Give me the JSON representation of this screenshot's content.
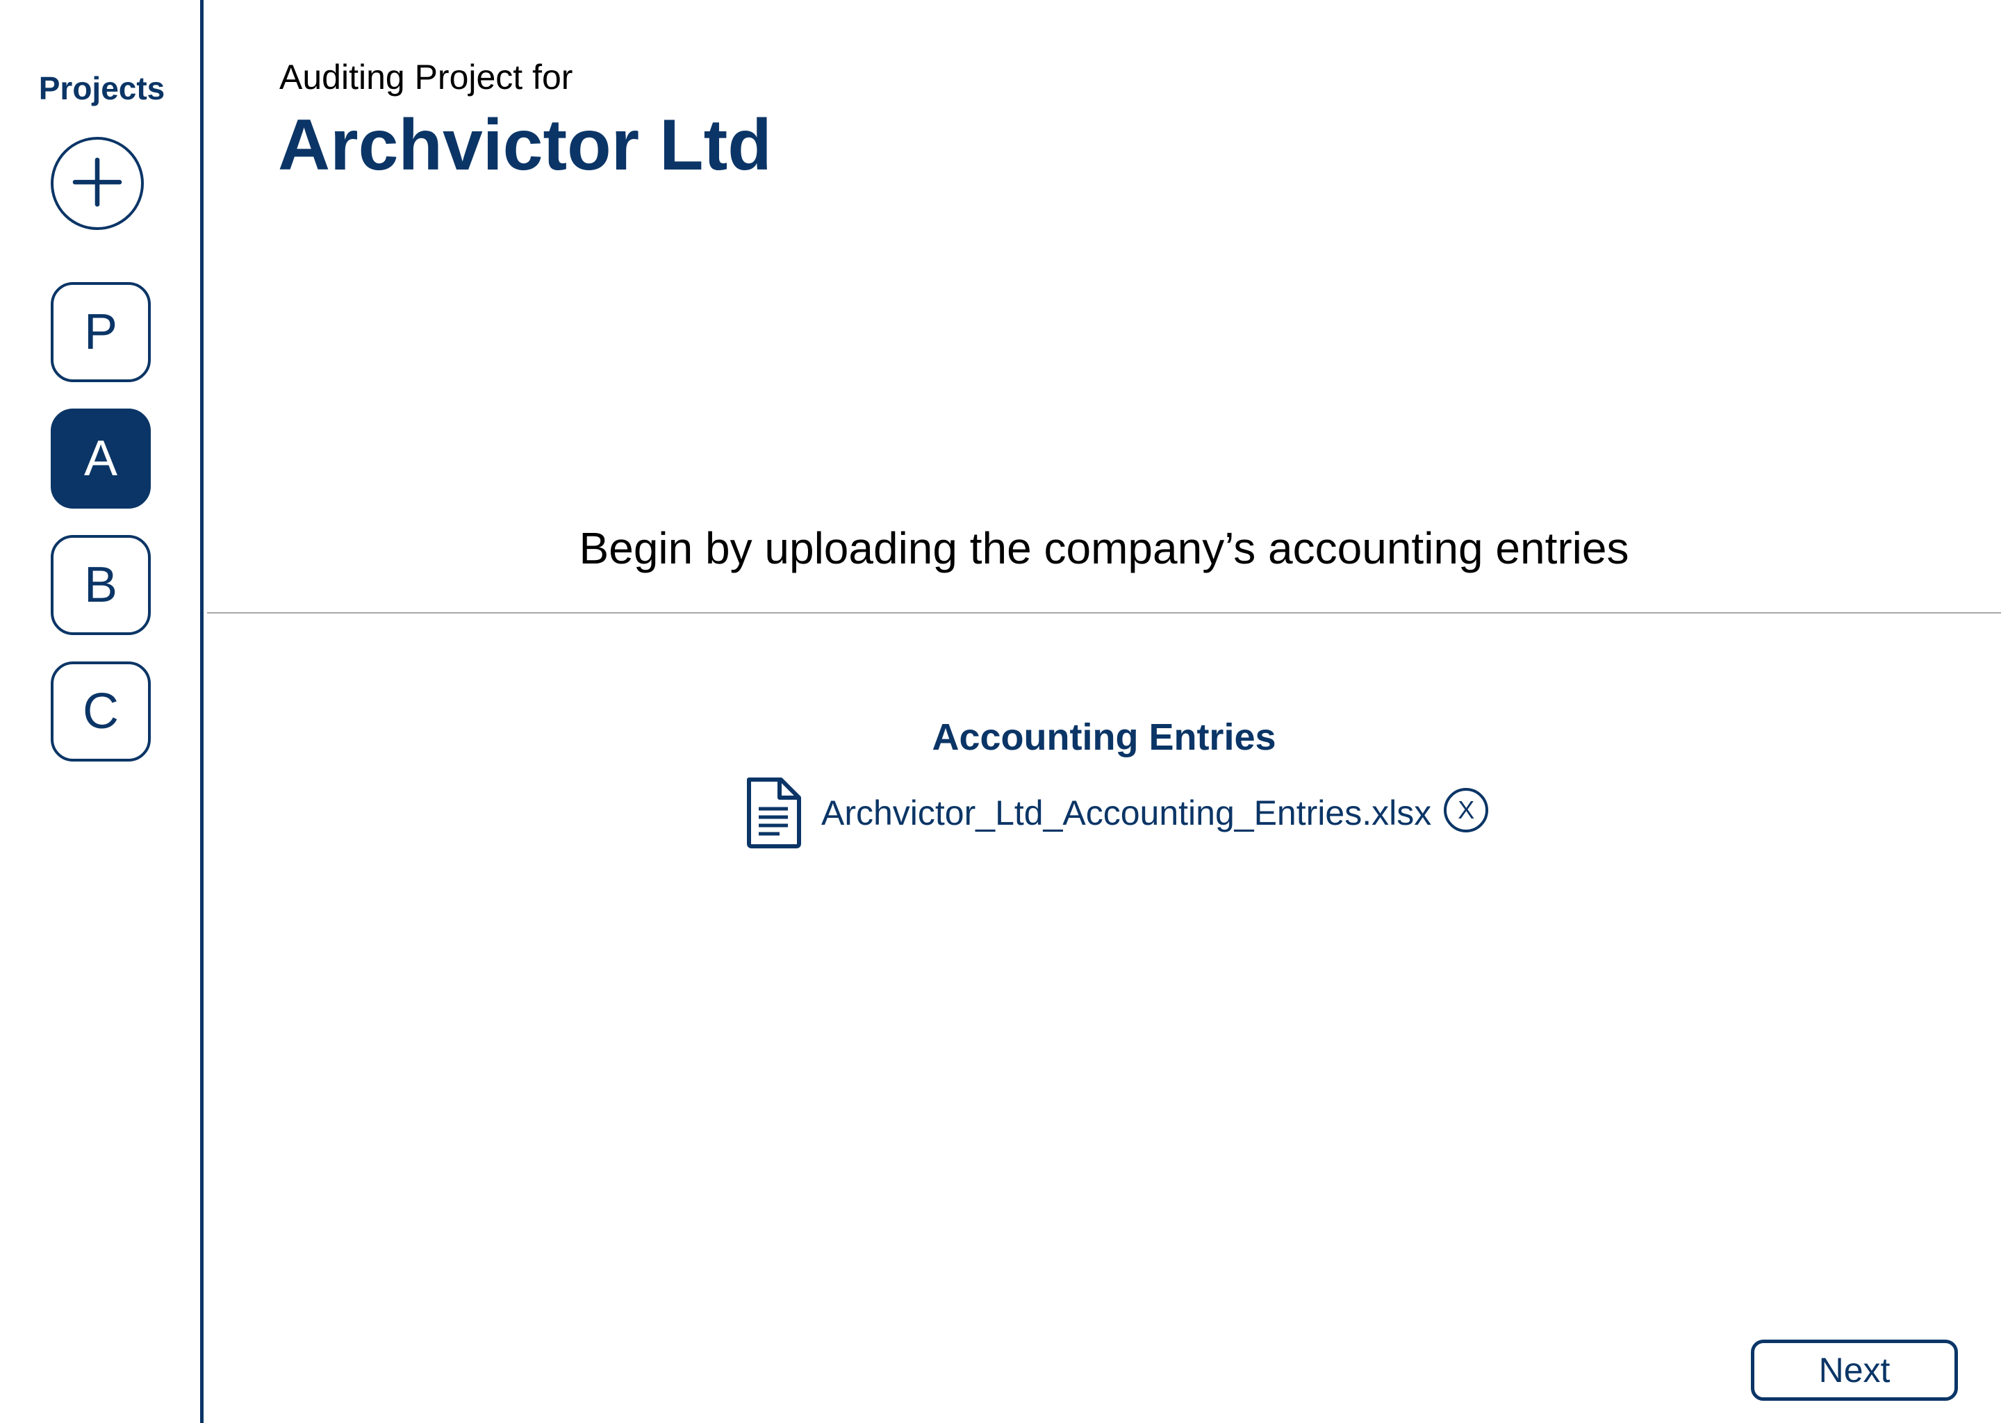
{
  "sidebar": {
    "title": "Projects",
    "add_icon": "plus-icon",
    "projects": [
      {
        "label": "P",
        "active": false
      },
      {
        "label": "A",
        "active": true
      },
      {
        "label": "B",
        "active": false
      },
      {
        "label": "C",
        "active": false
      }
    ]
  },
  "header": {
    "subtitle": "Auditing Project for",
    "title": "Archvictor Ltd"
  },
  "main": {
    "prompt": "Begin by uploading the company’s accounting entries",
    "upload": {
      "section_title": "Accounting Entries",
      "file_icon": "document-icon",
      "file_name": "Archvictor_Ltd_Accounting_Entries.xlsx",
      "remove_label": "X"
    }
  },
  "footer": {
    "next_label": "Next"
  },
  "colors": {
    "accent": "#0b3566",
    "divider": "#a8a8a8"
  }
}
